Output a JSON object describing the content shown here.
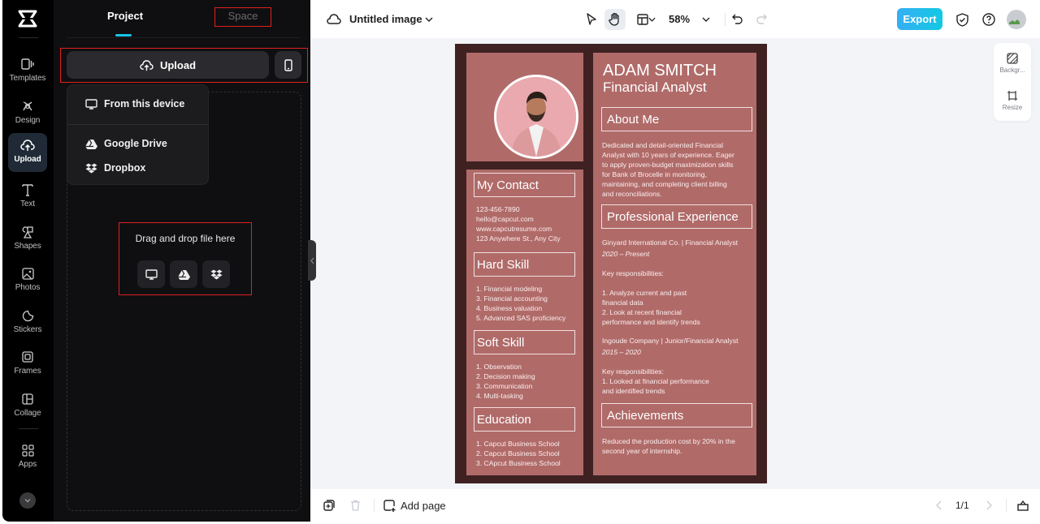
{
  "rail": {
    "items": [
      {
        "label": "Templates",
        "icon": "templates-icon"
      },
      {
        "label": "Design",
        "icon": "design-icon"
      },
      {
        "label": "Upload",
        "icon": "upload-cloud-icon",
        "active": true
      },
      {
        "label": "Text",
        "icon": "text-icon"
      },
      {
        "label": "Shapes",
        "icon": "shapes-icon"
      },
      {
        "label": "Photos",
        "icon": "photos-icon"
      },
      {
        "label": "Stickers",
        "icon": "stickers-icon"
      },
      {
        "label": "Frames",
        "icon": "frames-icon"
      },
      {
        "label": "Collage",
        "icon": "collage-icon"
      },
      {
        "label": "Apps",
        "icon": "apps-icon"
      }
    ]
  },
  "panel": {
    "tabs": [
      {
        "label": "Project",
        "active": true
      },
      {
        "label": "Space",
        "active": false
      }
    ],
    "upload_label": "Upload",
    "menu": [
      {
        "label": "From this device",
        "icon": "monitor-icon"
      },
      {
        "label": "Google Drive",
        "icon": "google-drive-icon"
      },
      {
        "label": "Dropbox",
        "icon": "dropbox-icon"
      }
    ],
    "drop_text": "Drag and drop file here"
  },
  "topbar": {
    "title": "Untitled image",
    "zoom": "58%",
    "export_label": "Export"
  },
  "side_tools": [
    {
      "label": "Backgr..."
    },
    {
      "label": "Resize"
    }
  ],
  "bottombar": {
    "add_page": "Add page",
    "page": "1/1"
  },
  "resume": {
    "name": "ADAM SMITCH",
    "role": "Financial Analyst",
    "about_title": "About Me",
    "about_text": "Dedicated and detail-oriented Financial\nAnalyst with 10 years of experience. Eager\nto apply proven-budget maximization skills\nfor Bank of Brocelle in monitoring,\nmaintaining, and completing client billing\nand reconciliations.",
    "exp_title": "Professional Experience",
    "exp1_head": "Ginyard International Co. | Financial Analyst",
    "exp1_years": "2020 – Present",
    "exp1_key": "Key responsibilities:",
    "exp1_list": "1. Analyze current and past\nfinancial data\n2. Look at recent financial\nperformance and identify trends",
    "exp2_head": "Ingoude Company | Junior/Financial Analyst",
    "exp2_years": "2015 – 2020",
    "exp2_list": "Key responsibilities:\n1. Looked at financial performance\n and identified trends",
    "ach_title": "Achievements",
    "ach_text": "Reduced the production cost by 20% in the\nsecond year of internship.",
    "contact_title": "My Contact",
    "contact_text": "123-456-7890\nhello@capcut.com\nwww.capcutresume.com\n123 Anywhere St., Any City",
    "hard_title": "Hard Skill",
    "hard_text": "1. Financial modeling\n3. Financial accounting\n4. Business valuation\n5. Advanced SAS proficiency",
    "soft_title": "Soft Skill",
    "soft_text": "1. Observation\n2. Decision making\n3. Communication\n4. Multi-tasking",
    "edu_title": "Education",
    "edu_text": "1. Capcut Business School\n2. Capcut Business School\n3. CApcut Business School"
  }
}
